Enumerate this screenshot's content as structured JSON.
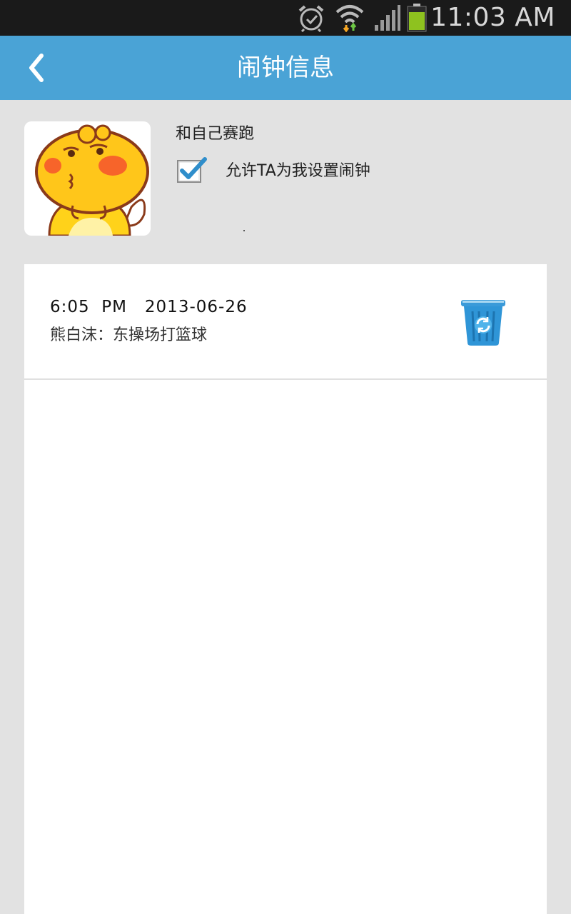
{
  "status_bar": {
    "time": "11:03 AM",
    "icons": [
      "alarm-icon",
      "wifi-icon",
      "signal-icon",
      "battery-icon"
    ]
  },
  "header": {
    "title": "闹钟信息",
    "back_icon": "chevron-left-icon"
  },
  "contact": {
    "avatar_icon": "cartoon-avatar",
    "name": "和自己赛跑",
    "permission": {
      "checked": true,
      "label": "允许TA为我设置闹钟"
    }
  },
  "alarms": [
    {
      "time": "6:05  PM",
      "date": "2013-06-26",
      "datetime": "6:05  PM   2013-06-26",
      "description": "熊白沫：东操场打篮球",
      "delete_icon": "trash-can-icon"
    }
  ],
  "colors": {
    "header_bg": "#4aa3d6",
    "status_bg": "#1a1a1a",
    "page_bg": "#e2e2e2",
    "check_accent": "#2f8ecb",
    "battery": "#8ec21f"
  }
}
